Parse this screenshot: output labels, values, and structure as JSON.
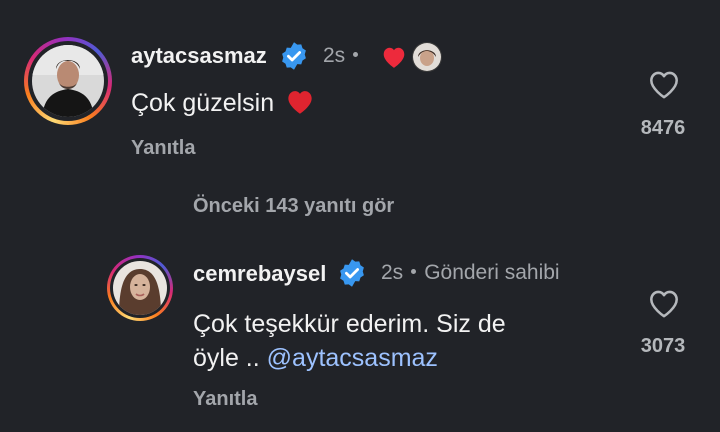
{
  "comments": [
    {
      "username": "aytacsasmaz",
      "time": "2s",
      "text": "Çok güzelsin",
      "reply_label": "Yanıtla",
      "like_count": "8476"
    }
  ],
  "view_previous_replies": "Önceki 143 yanıtı gör",
  "replies": [
    {
      "username": "cemrebaysel",
      "time": "2s",
      "author_tag": "Gönderi sahibi",
      "text_line1": "Çok teşekkür ederim. Siz de",
      "text_line2_prefix": "öyle ..",
      "mention": "@aytacsasmaz",
      "reply_label": "Yanıtla",
      "like_count": "3073"
    }
  ],
  "colors": {
    "background": "#212328",
    "verified_badge": "#3897f0",
    "heart": "#ed2a3c",
    "mention": "#9dc2ff",
    "secondary_text": "#a3a6ab"
  },
  "icons": {
    "verified": "verified-badge-icon",
    "like": "heart-outline-icon",
    "creator_liked": "red-heart-icon",
    "emoji": "red-heart-emoji"
  }
}
